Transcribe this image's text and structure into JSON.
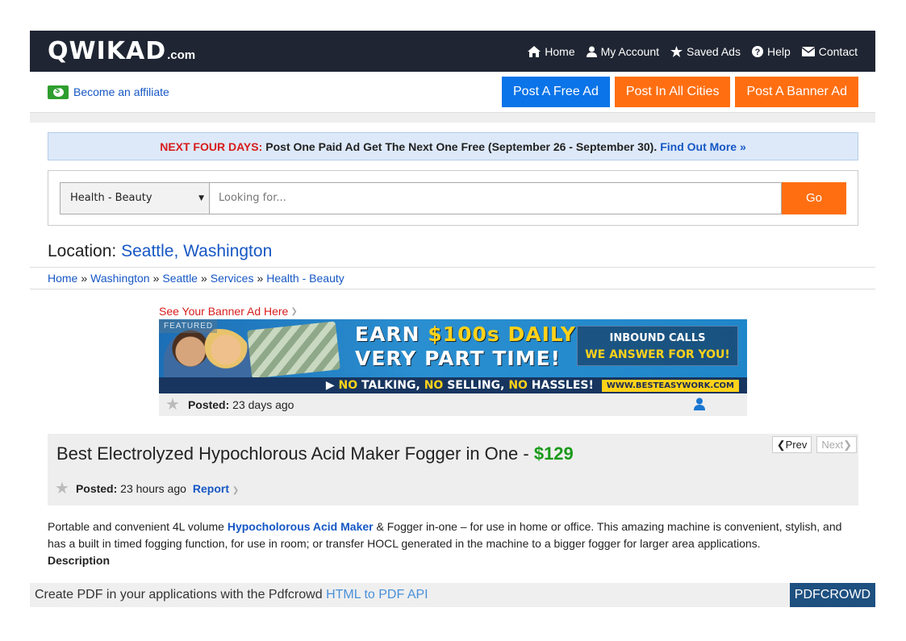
{
  "header": {
    "logo_main": "QWIKAD",
    "logo_suffix": ".com",
    "nav": [
      {
        "label": "Home",
        "icon": "home-icon"
      },
      {
        "label": "My Account",
        "icon": "user-icon"
      },
      {
        "label": "Saved Ads",
        "icon": "star-icon"
      },
      {
        "label": "Help",
        "icon": "help-icon"
      },
      {
        "label": "Contact",
        "icon": "envelope-icon"
      }
    ]
  },
  "subheader": {
    "affiliate_label": "Become an affiliate",
    "post_free": "Post A Free Ad",
    "post_all": "Post In All Cities",
    "post_banner": "Post A Banner Ad"
  },
  "promo": {
    "lead": "NEXT FOUR DAYS:",
    "text": "Post One Paid Ad Get The Next One Free (September 26 - September 30).",
    "link": "Find Out More »"
  },
  "search": {
    "category": "Health - Beauty",
    "placeholder": "Looking for...",
    "go_label": "Go"
  },
  "location": {
    "label": "Location:",
    "city": "Seattle, Washington"
  },
  "breadcrumb": [
    "Home",
    "Washington",
    "Seattle",
    "Services",
    "Health - Beauty"
  ],
  "banner_ad": {
    "see_label": "See Your Banner Ad Here",
    "featured": "FEATURED",
    "line1_a": "EARN ",
    "line1_b": "$100s DAILY",
    "line2": "VERY PART TIME!",
    "box_line1": "INBOUND CALLS",
    "box_line2": "WE ANSWER FOR YOU!",
    "bottom_a": "▶ ",
    "bottom_b": "NO",
    "bottom_c": " TALKING, ",
    "bottom_d": "NO",
    "bottom_e": " SELLING, ",
    "bottom_f": "NO",
    "bottom_g": " HASSLES!",
    "url": "WWW.BESTEASYWORK.COM",
    "posted_label": "Posted:",
    "posted_value": "23 days ago"
  },
  "listing": {
    "title": "Best Electrolyzed Hypochlorous Acid Maker Fogger in One - ",
    "price": "$129",
    "prev": "Prev",
    "next": "Next",
    "posted_label": "Posted:",
    "posted_value": "23 hours ago",
    "report": "Report"
  },
  "description": {
    "pre": "Portable and convenient 4L volume ",
    "keyword": "Hypocholorous Acid Maker",
    "post": " & Fogger in-one – for use in home or office. This amazing machine is convenient, stylish, and has a built in timed fogging function, for use in room; or transfer HOCL generated in the machine to a bigger fogger for larger area applications.",
    "label": "Description"
  },
  "pdf": {
    "text": "Create PDF in your applications with the Pdfcrowd ",
    "link": "HTML to PDF API",
    "button": "PDFCROWD"
  },
  "colors": {
    "header_bg": "#1f2532",
    "blue_button": "#0a74e8",
    "orange_button": "#ff6f12",
    "link_blue": "#1657c4",
    "price_green": "#1a9a1a",
    "promo_red": "#d81c1c"
  }
}
